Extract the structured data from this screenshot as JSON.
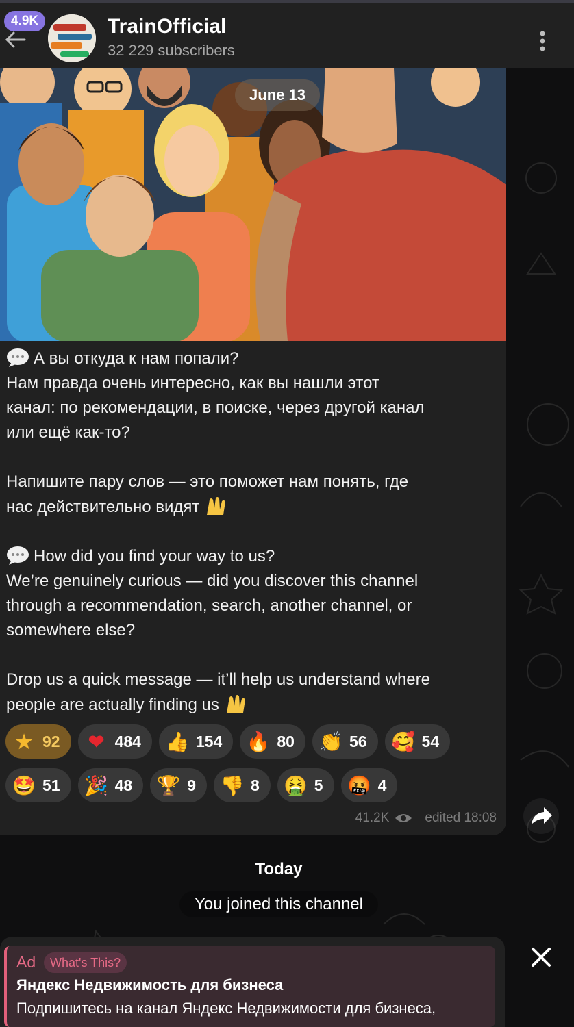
{
  "header": {
    "unread_badge": "4.9K",
    "title": "TrainOfficial",
    "subtitle": "32 229 subscribers"
  },
  "post": {
    "date": "June 13",
    "paragraphs": [
      {
        "emoji": "speech-bubble",
        "lines": [
          "А вы откуда к нам попали?",
          "Нам правда очень интересно, как вы нашли этот",
          "канал: по рекомендации, в поиске, через другой канал",
          "или ещё как-то?"
        ]
      },
      {
        "lines": [
          "Напишите пару слов — это поможет нам понять, где",
          "нас действительно видят"
        ],
        "trailing_emoji": "raising-hands"
      },
      {
        "emoji": "speech-bubble",
        "lines": [
          "How did you find your way to us?",
          "We’re genuinely curious — did you discover this channel",
          "through a recommendation, search, another channel, or",
          "somewhere else?"
        ]
      },
      {
        "lines": [
          "Drop us a quick message — it’ll help us understand where",
          "people are actually finding us"
        ],
        "trailing_emoji": "raising-hands"
      }
    ],
    "reactions_row1": [
      {
        "icon": "star-icon",
        "glyph": "★",
        "count": "92",
        "selected": true
      },
      {
        "icon": "heart-icon",
        "glyph": "❤",
        "count": "484"
      },
      {
        "icon": "thumbs-up-icon",
        "glyph": "👍",
        "count": "154"
      },
      {
        "icon": "fire-icon",
        "glyph": "🔥",
        "count": "80"
      },
      {
        "icon": "clap-icon",
        "glyph": "👏",
        "count": "56"
      },
      {
        "icon": "smiling-hearts-icon",
        "glyph": "🥰",
        "count": "54"
      }
    ],
    "reactions_row2": [
      {
        "icon": "star-struck-icon",
        "glyph": "🤩",
        "count": "51"
      },
      {
        "icon": "party-popper-icon",
        "glyph": "🎉",
        "count": "48"
      },
      {
        "icon": "trophy-icon",
        "glyph": "🏆",
        "count": "9"
      },
      {
        "icon": "thumbs-down-icon",
        "glyph": "👎",
        "count": "8"
      },
      {
        "icon": "nauseated-icon",
        "glyph": "🤮",
        "count": "5"
      },
      {
        "icon": "cursing-face-icon",
        "glyph": "🤬",
        "count": "4"
      }
    ],
    "views": "41.2K",
    "edited": "edited 18:08"
  },
  "service": {
    "today": "Today",
    "joined": "You joined this channel"
  },
  "ad": {
    "label": "Ad",
    "whats_this": "What's This?",
    "title": "Яндекс Недвижимость для бизнеса",
    "text": "Подпишитесь на канал Яндекс Недвижимости для бизнеса,"
  },
  "colors": {
    "accent": "#8774e1",
    "bubble": "#212121",
    "ad_accent": "#e66a86"
  }
}
